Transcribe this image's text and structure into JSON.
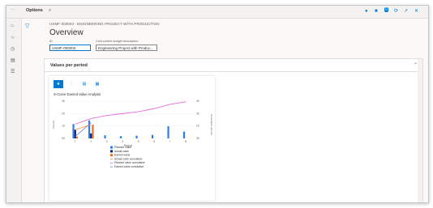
{
  "titlebar": {
    "menu_icon": "menu-icon",
    "title": "Options",
    "search_icon": "search-icon"
  },
  "nav": [
    "home-icon",
    "star-icon",
    "clock-icon",
    "modules-icon",
    "list-icon"
  ],
  "breadcrumb": "USMF 000003 : ENGINEERING PROJECT WITH PRODUCTION",
  "page_title": "Overview",
  "fields": {
    "id_label": "ID",
    "id_value": "USMF-000003",
    "desc_label": "Cost control budget description",
    "desc_value": "Engineering Project with Produc..."
  },
  "section": {
    "title": "Values per period"
  },
  "chart_types": [
    "bar-chart-icon",
    "column-icon",
    "stacked-icon",
    "grouped-icon"
  ],
  "colors": {
    "planned": "#2b7de9",
    "actual": "#0b1c6b",
    "earned": "#e8702a",
    "actual_cum": "#ff8c3a",
    "planned_cum": "#e25bd6",
    "earned_cum": "#6a7fe0"
  },
  "chart_data": {
    "type": "bar",
    "title": "S-Curve Earned Value Analysis",
    "xlabel": "Period",
    "ylabel": "Amount",
    "y2label": "Cumulative amount",
    "categories": [
      "1",
      "2",
      "3",
      "4",
      "5",
      "6",
      "7",
      "8"
    ],
    "ylim": [
      0,
      3000
    ],
    "y_ticks": [
      "0K",
      "1K",
      "2K",
      "3K"
    ],
    "y2lim": [
      0,
      3000
    ],
    "y2_ticks": [
      "0K",
      "1K",
      "2K",
      "3K"
    ],
    "series": [
      {
        "name": "Planned Value",
        "values": [
          1150,
          1450,
          250,
          180,
          220,
          280,
          980,
          550
        ]
      },
      {
        "name": "Actual costs",
        "values": [
          700,
          400,
          0,
          0,
          0,
          0,
          0,
          0
        ]
      },
      {
        "name": "Earned value",
        "values": [
          150,
          1100,
          0,
          0,
          0,
          0,
          0,
          0
        ]
      }
    ],
    "line_series": [
      {
        "name": "Actual costs cumulative",
        "values": [
          700,
          1100
        ]
      },
      {
        "name": "Planned value cumulative",
        "values": [
          1150,
          1600,
          1850,
          2000,
          2150,
          2400,
          2750,
          2950
        ]
      },
      {
        "name": "Earned value cumulative",
        "values": [
          150,
          1250
        ]
      }
    ],
    "legend": "bottom"
  }
}
